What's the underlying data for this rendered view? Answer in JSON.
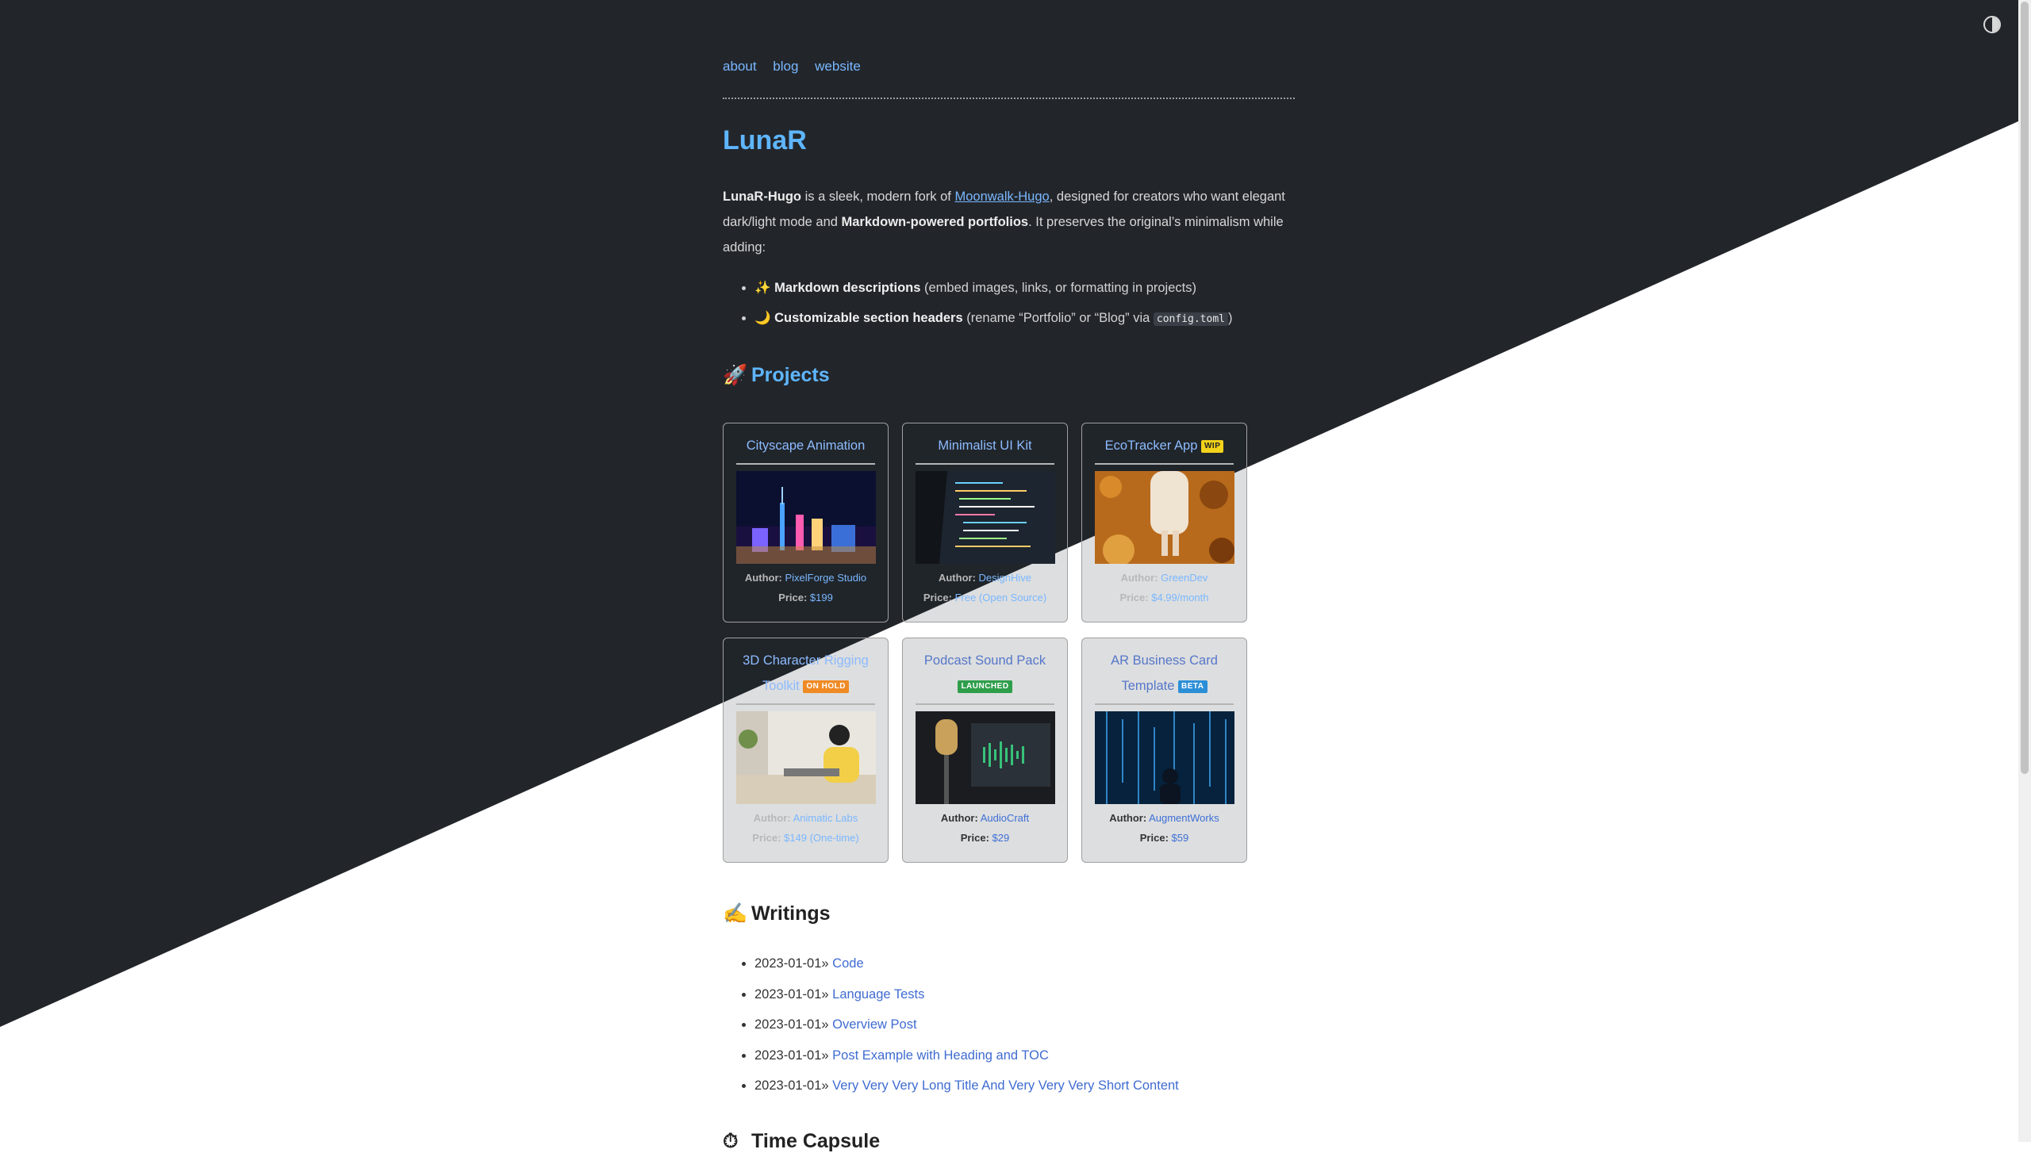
{
  "nav": {
    "items": [
      "about",
      "blog",
      "website"
    ]
  },
  "site": {
    "title": "LunaR"
  },
  "intro": {
    "brand": "LunaR-Hugo",
    "text1": " is a sleek, modern fork of ",
    "fork_link": "Moonwalk-Hugo",
    "text2": ", designed for creators who want elegant dark/light mode and ",
    "bold2": "Markdown-powered portfolios",
    "text3": ". It preserves the original’s minimalism while adding:"
  },
  "features": [
    {
      "icon": "✨",
      "bold": "Markdown descriptions",
      "text": " (embed images, links, or formatting in projects)"
    },
    {
      "icon": "🌙",
      "bold": "Customizable section headers",
      "text": " (rename “Portfolio” or “Blog” via ",
      "code": "config.toml",
      "tail": ")"
    }
  ],
  "sections": {
    "projects": {
      "icon": "🚀",
      "title": "Projects"
    },
    "writings": {
      "icon": "✍️",
      "title": "Writings"
    },
    "timeline": {
      "icon": "⏱",
      "title": "Time Capsule"
    }
  },
  "labels": {
    "author": "Author:",
    "price": "Price:"
  },
  "projects": [
    {
      "title": "Cityscape Animation",
      "badge": "",
      "author": "PixelForge Studio",
      "price": "$199"
    },
    {
      "title": "Minimalist UI Kit",
      "badge": "",
      "author": "DesignHive",
      "price": "Free (Open Source)"
    },
    {
      "title": "EcoTracker App",
      "badge": "WIP",
      "author": "GreenDev",
      "price": "$4.99/month"
    },
    {
      "title": "3D Character Rigging Toolkit",
      "badge": "ON HOLD",
      "author": "Animatic Labs",
      "price": "$149 (One-time)"
    },
    {
      "title": "Podcast Sound Pack",
      "badge": "LAUNCHED",
      "author": "AudioCraft",
      "price": "$29"
    },
    {
      "title": "AR Business Card Template",
      "badge": "BETA",
      "author": "AugmentWorks",
      "price": "$59"
    }
  ],
  "badge_colors": {
    "WIP": "#f2d21b",
    "ON HOLD": "#f08a24",
    "LAUNCHED": "#2e9e4a",
    "BETA": "#2b8fd8"
  },
  "writings": [
    {
      "date": "2023-01-01»",
      "title": "Code"
    },
    {
      "date": "2023-01-01»",
      "title": "Language Tests"
    },
    {
      "date": "2023-01-01»",
      "title": "Overview Post"
    },
    {
      "date": "2023-01-01»",
      "title": "Post Example with Heading and TOC"
    },
    {
      "date": "2023-01-01»",
      "title": "Very Very Very Long Title And Very Very Very Short Content"
    }
  ]
}
